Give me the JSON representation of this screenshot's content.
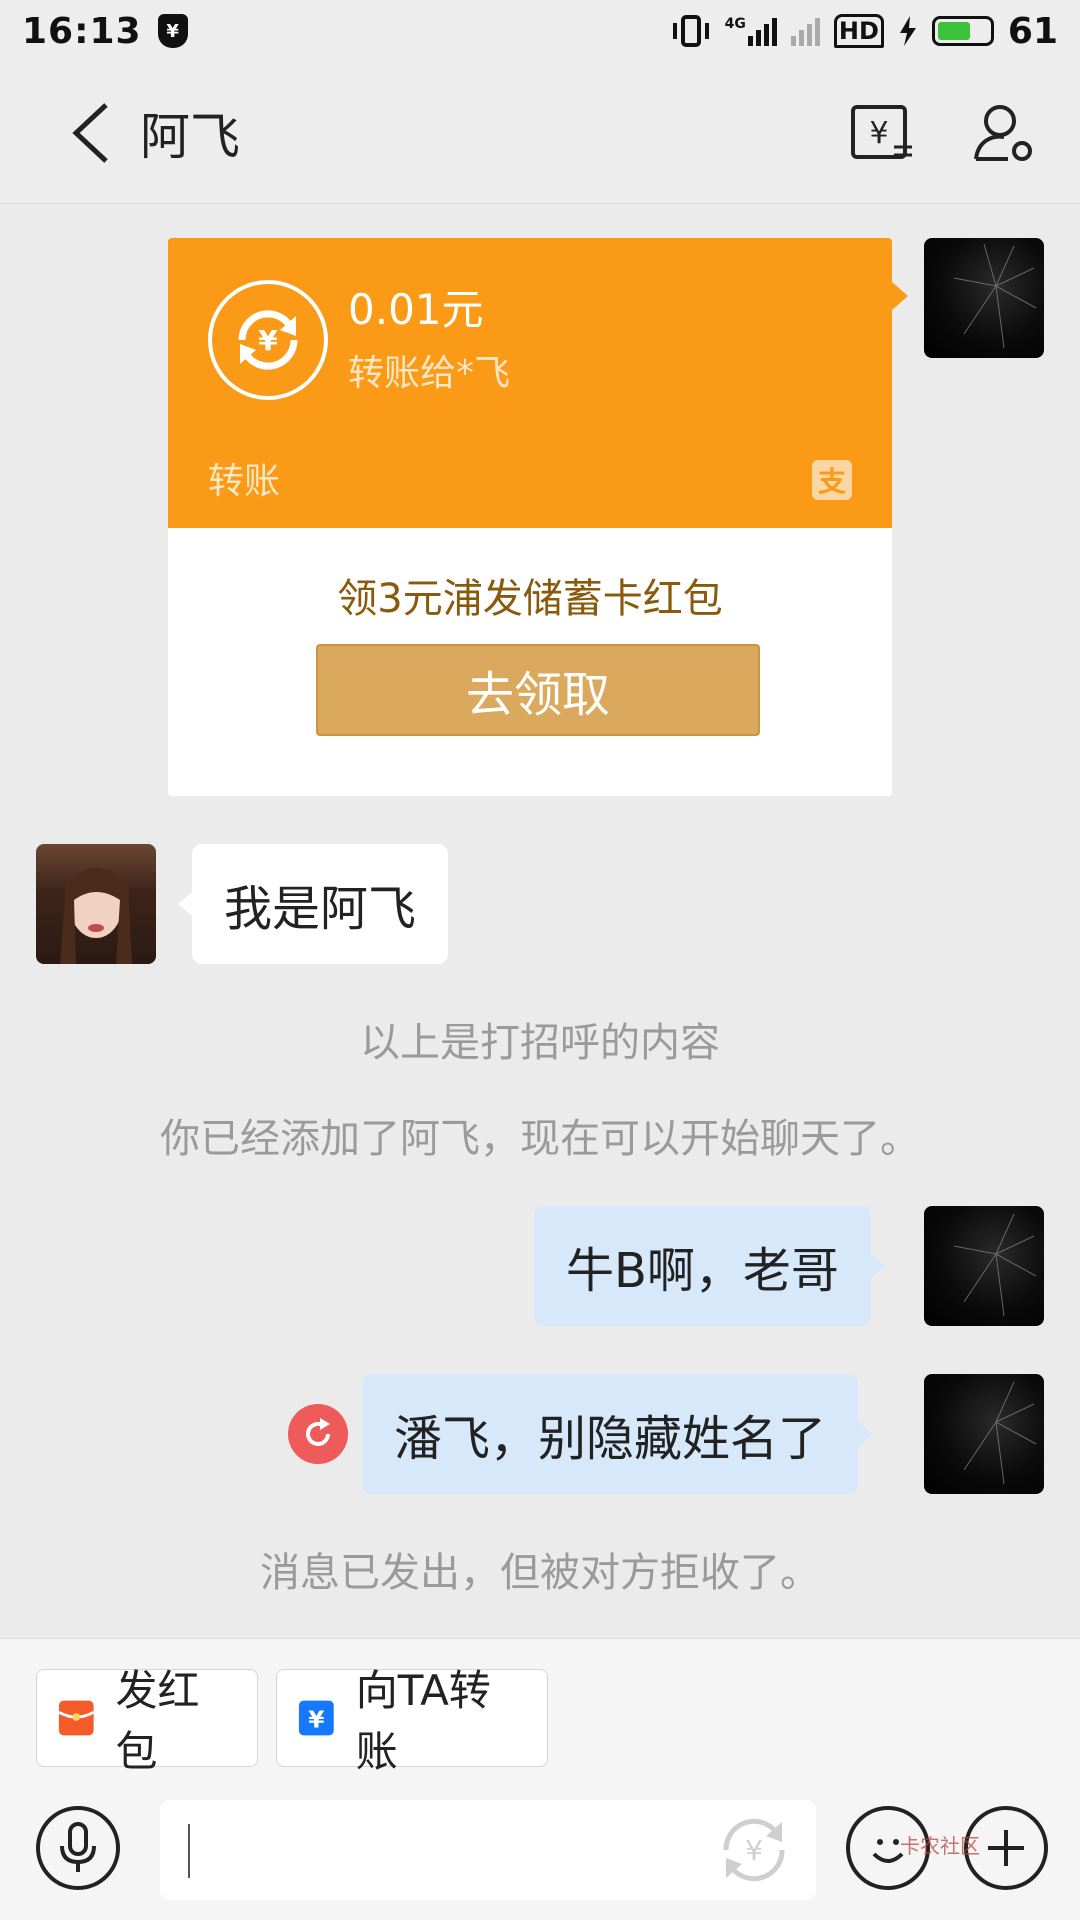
{
  "status_bar": {
    "time": "16:13",
    "network": "4G",
    "hd": "HD",
    "battery": "61"
  },
  "header": {
    "title": "阿飞",
    "icons": [
      "back-icon",
      "transfer-yuan-icon",
      "profile-settings-icon"
    ]
  },
  "transfer_card": {
    "amount": "0.01元",
    "recipient": "转账给*飞",
    "type_label": "转账",
    "alipay_glyph": "支",
    "promo_text": "领3元浦发储蓄卡红包",
    "promo_button": "去领取",
    "colors": {
      "card": "#fa9a17",
      "button": "#dba95e"
    }
  },
  "messages": [
    {
      "side": "left",
      "text": "我是阿飞"
    },
    {
      "side": "right",
      "text": "牛B啊，老哥"
    },
    {
      "side": "right",
      "text": "潘飞，别隐藏姓名了"
    }
  ],
  "system_messages": [
    "以上是打招呼的内容",
    "你已经添加了阿飞，现在可以开始聊天了。",
    "消息已发出，但被对方拒收了。"
  ],
  "quick_actions": [
    {
      "label": "发红包",
      "icon": "red-packet-icon",
      "color": "#f45a2a"
    },
    {
      "label": "向TA转账",
      "icon": "transfer-icon",
      "color": "#1677ff"
    }
  ],
  "input": {
    "placeholder": "",
    "watermark": "卡农社区"
  }
}
